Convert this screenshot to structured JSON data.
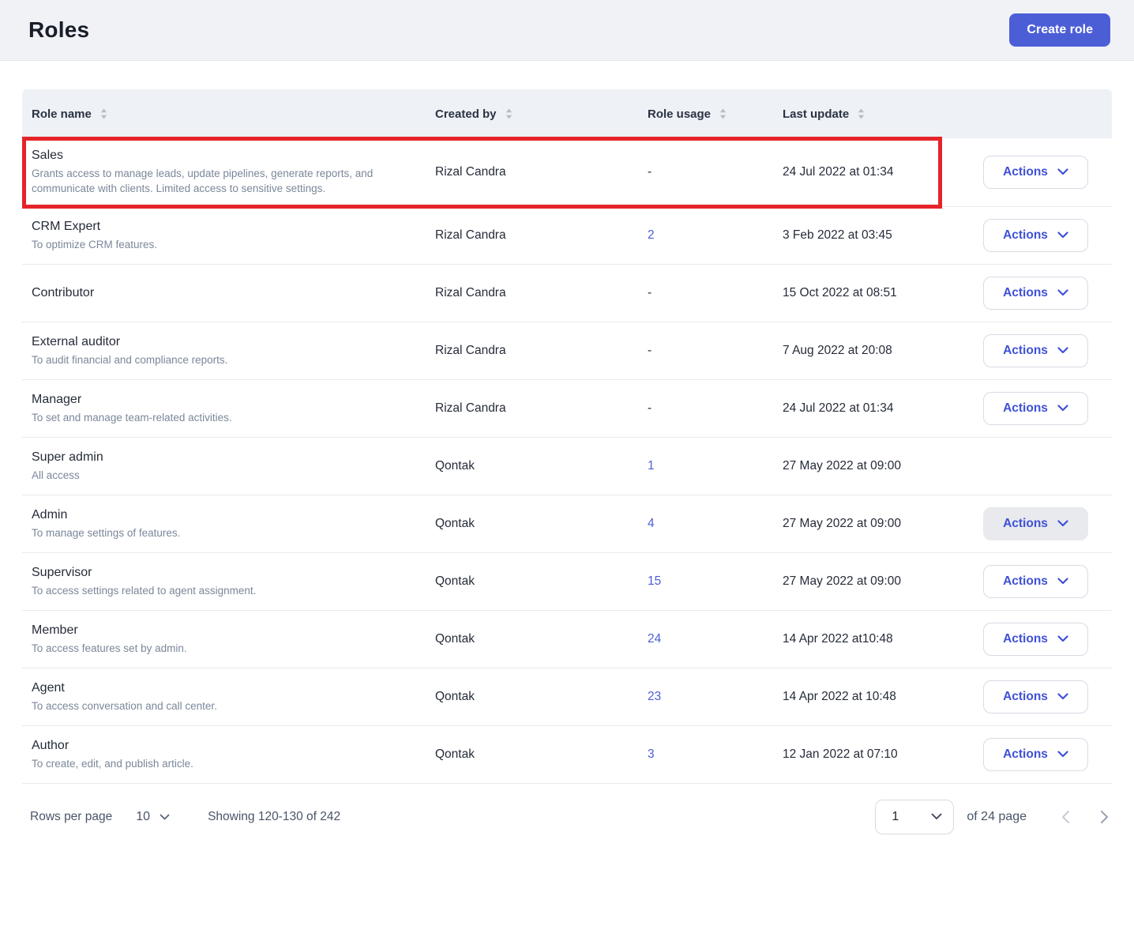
{
  "header": {
    "title": "Roles",
    "create_button_label": "Create role"
  },
  "colors": {
    "accent": "#4c5ed6",
    "link": "#4c5ed6",
    "highlight_red": "#e5242a",
    "actions_text": "#3f51d6"
  },
  "table": {
    "columns": [
      {
        "label": "Role name"
      },
      {
        "label": "Created by"
      },
      {
        "label": "Role usage"
      },
      {
        "label": "Last update"
      }
    ],
    "actions_label": "Actions",
    "rows": [
      {
        "name": "Sales",
        "description": "Grants access to manage leads, update pipelines, generate reports, and communicate with clients. Limited access to sensitive settings.",
        "created_by": "Rizal Candra",
        "usage": "-",
        "usage_is_link": false,
        "last_update": "24 Jul 2022 at 01:34",
        "has_actions": true,
        "actions_state": "default",
        "highlighted": true
      },
      {
        "name": "CRM Expert",
        "description": "To optimize CRM features.",
        "created_by": "Rizal Candra",
        "usage": "2",
        "usage_is_link": true,
        "last_update": "3 Feb 2022 at 03:45",
        "has_actions": true,
        "actions_state": "default",
        "highlighted": false
      },
      {
        "name": "Contributor",
        "description": "",
        "created_by": "Rizal Candra",
        "usage": "-",
        "usage_is_link": false,
        "last_update": "15 Oct 2022 at 08:51",
        "has_actions": true,
        "actions_state": "default",
        "highlighted": false
      },
      {
        "name": "External auditor",
        "description": "To audit financial and compliance reports.",
        "created_by": "Rizal Candra",
        "usage": "-",
        "usage_is_link": false,
        "last_update": "7 Aug 2022 at 20:08",
        "has_actions": true,
        "actions_state": "default",
        "highlighted": false
      },
      {
        "name": "Manager",
        "description": "To set and manage team-related activities.",
        "created_by": "Rizal Candra",
        "usage": "-",
        "usage_is_link": false,
        "last_update": "24 Jul 2022 at 01:34",
        "has_actions": true,
        "actions_state": "default",
        "highlighted": false
      },
      {
        "name": "Super admin",
        "description": "All access",
        "created_by": "Qontak",
        "usage": "1",
        "usage_is_link": true,
        "last_update": "27 May 2022 at 09:00",
        "has_actions": false,
        "actions_state": "none",
        "highlighted": false
      },
      {
        "name": "Admin",
        "description": "To manage settings of features.",
        "created_by": "Qontak",
        "usage": "4",
        "usage_is_link": true,
        "last_update": "27 May 2022 at 09:00",
        "has_actions": true,
        "actions_state": "active",
        "highlighted": false
      },
      {
        "name": "Supervisor",
        "description": "To access settings related to agent assignment.",
        "created_by": "Qontak",
        "usage": "15",
        "usage_is_link": true,
        "last_update": "27 May 2022 at 09:00",
        "has_actions": true,
        "actions_state": "default",
        "highlighted": false
      },
      {
        "name": "Member",
        "description": "To access features set by admin.",
        "created_by": "Qontak",
        "usage": "24",
        "usage_is_link": true,
        "last_update": "14 Apr 2022 at10:48",
        "has_actions": true,
        "actions_state": "default",
        "highlighted": false
      },
      {
        "name": "Agent",
        "description": "To access conversation and call center.",
        "created_by": "Qontak",
        "usage": "23",
        "usage_is_link": true,
        "last_update": "14 Apr 2022 at 10:48",
        "has_actions": true,
        "actions_state": "default",
        "highlighted": false
      },
      {
        "name": "Author",
        "description": "To create, edit, and publish article.",
        "created_by": "Qontak",
        "usage": "3",
        "usage_is_link": true,
        "last_update": "12 Jan 2022 at 07:10",
        "has_actions": true,
        "actions_state": "default",
        "highlighted": false
      }
    ]
  },
  "pagination": {
    "rows_per_page_label": "Rows per page",
    "rows_per_page_value": "10",
    "showing_text": "Showing 120-130 of 242",
    "current_page": "1",
    "total_pages_text": "of 24 page"
  }
}
